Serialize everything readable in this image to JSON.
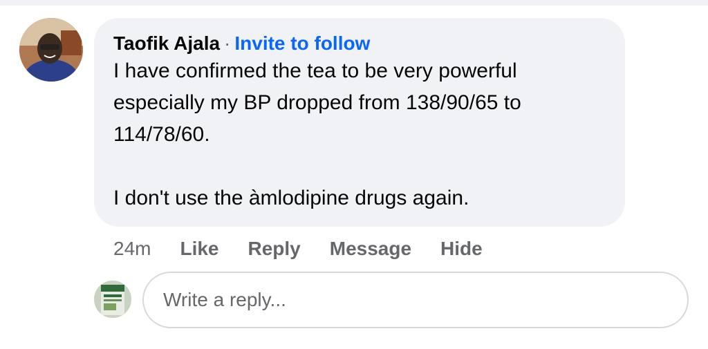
{
  "comment": {
    "author": "Taofik Ajala",
    "separator": "·",
    "invite_label": "Invite to follow",
    "lines": [
      "I have confirmed the tea to be very powerful",
      "especially my BP dropped from 138/90/65 to",
      "114/78/60.",
      "",
      "I don't use the àmlodipine drugs again."
    ],
    "timestamp": "24m",
    "actions": {
      "like": "Like",
      "reply": "Reply",
      "message": "Message",
      "hide": "Hide"
    }
  },
  "reply_box": {
    "placeholder": "Write a reply..."
  },
  "colors": {
    "bubble": "#f0f2f5",
    "link": "#0866ff",
    "secondary_text": "#65676b"
  }
}
